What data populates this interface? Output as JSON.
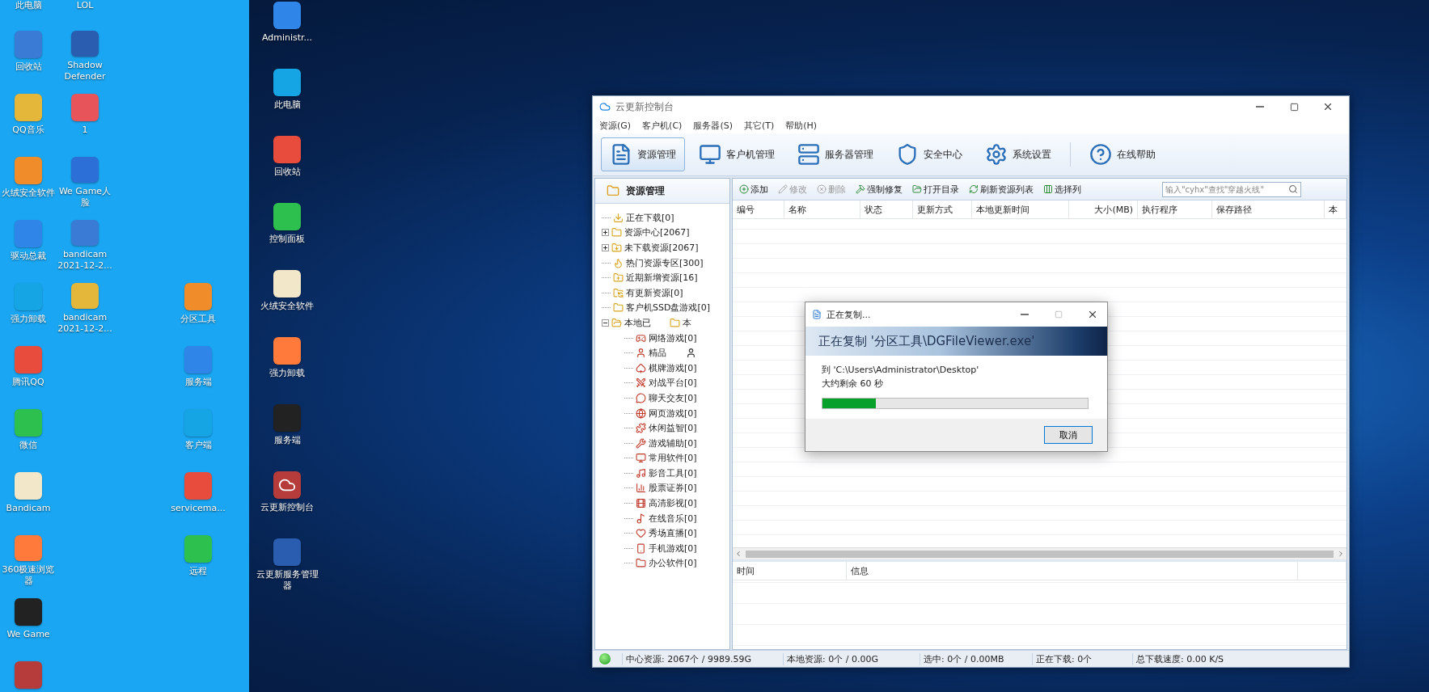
{
  "desktop": {
    "columns": [
      {
        "icons": [
          {
            "kind": "cut",
            "label": "此电脑"
          },
          {
            "kind": "app",
            "label": "回收站"
          },
          {
            "kind": "app",
            "label": "QQ音乐"
          },
          {
            "kind": "app",
            "label": "火绒安全软件"
          },
          {
            "kind": "app",
            "label": "驱动总裁"
          },
          {
            "kind": "app",
            "label": "强力卸载"
          },
          {
            "kind": "app",
            "label": "腾讯QQ"
          },
          {
            "kind": "app",
            "label": "微信"
          },
          {
            "kind": "app",
            "label": "Bandicam"
          },
          {
            "kind": "app",
            "label": "360极速浏览器"
          },
          {
            "kind": "app",
            "label": "We Game"
          },
          {
            "kind": "app"
          }
        ]
      },
      {
        "icons": [
          {
            "kind": "cut",
            "label": "LOL"
          },
          {
            "kind": "app",
            "label": "Shadow Defender"
          },
          {
            "kind": "app",
            "label": "1"
          },
          {
            "kind": "app",
            "label": "We Game人脸"
          },
          {
            "kind": "app",
            "label": "bandicam 2021-12-2..."
          },
          {
            "kind": "app",
            "label": "bandicam 2021-12-2..."
          }
        ]
      },
      {
        "icons": [
          {
            "kind": "app",
            "label": "分区工具"
          },
          {
            "kind": "app",
            "label": "服务端"
          },
          {
            "kind": "app",
            "label": "客户端"
          },
          {
            "kind": "app",
            "label": "servicema..."
          },
          {
            "kind": "app",
            "label": "远程"
          }
        ]
      }
    ],
    "dark_column": [
      {
        "label": "Administr..."
      },
      {
        "label": "此电脑"
      },
      {
        "label": "回收站"
      },
      {
        "label": "控制面板"
      },
      {
        "label": "火绒安全软件"
      },
      {
        "label": "强力卸载"
      },
      {
        "label": "服务端"
      },
      {
        "label": "云更新控制台"
      },
      {
        "label": "云更新服务管理器"
      }
    ]
  },
  "window": {
    "title": "云更新控制台",
    "menu": [
      "资源(G)",
      "客户机(C)",
      "服务器(S)",
      "其它(T)",
      "帮助(H)"
    ],
    "toolbar": [
      {
        "label": "资源管理",
        "selected": true
      },
      {
        "label": "客户机管理",
        "selected": false
      },
      {
        "label": "服务器管理",
        "selected": false
      },
      {
        "label": "安全中心",
        "selected": false
      },
      {
        "label": "系统设置",
        "selected": false
      },
      {
        "label": "在线帮助",
        "selected": false
      }
    ],
    "sidebar": {
      "title": "资源管理",
      "tree": [
        {
          "label": "正在下载[0]"
        },
        {
          "label": "资源中心[2067]",
          "expanded": false
        },
        {
          "label": "未下载资源[2067]",
          "expanded": false
        },
        {
          "label": "热门资源专区[300]"
        },
        {
          "label": "近期新增资源[16]"
        },
        {
          "label": "有更新资源[0]"
        },
        {
          "label": "客户机SSD盘游戏[0]"
        },
        {
          "label": "本地已",
          "ghost_label": "本",
          "expanded": true,
          "children": [
            {
              "label": "网络游戏[0]"
            },
            {
              "label": "精品",
              "ghost_icon": true
            },
            {
              "label": "棋牌游戏[0]"
            },
            {
              "label": "对战平台[0]"
            },
            {
              "label": "聊天交友[0]"
            },
            {
              "label": "网页游戏[0]"
            },
            {
              "label": "休闲益智[0]"
            },
            {
              "label": "游戏辅助[0]"
            },
            {
              "label": "常用软件[0]"
            },
            {
              "label": "影音工具[0]"
            },
            {
              "label": "股票证券[0]"
            },
            {
              "label": "高清影视[0]"
            },
            {
              "label": "在线音乐[0]"
            },
            {
              "label": "秀场直播[0]"
            },
            {
              "label": "手机游戏[0]"
            },
            {
              "label": "办公软件[0]"
            }
          ]
        }
      ]
    },
    "actions": [
      {
        "label": "添加",
        "disabled": false
      },
      {
        "label": "修改",
        "disabled": true
      },
      {
        "label": "删除",
        "disabled": true
      },
      {
        "label": "强制修复",
        "disabled": false
      },
      {
        "label": "打开目录",
        "disabled": false
      },
      {
        "label": "刷新资源列表",
        "disabled": false
      },
      {
        "label": "选择列",
        "disabled": false
      }
    ],
    "search": {
      "placeholder": "输入\"cyhx\"查找\"穿越火线\""
    },
    "table": {
      "columns": [
        "编号",
        "名称",
        "状态",
        "更新方式",
        "本地更新时间",
        "大小(MB)",
        "执行程序",
        "保存路径",
        "本"
      ]
    },
    "log": {
      "columns": [
        "时间",
        "信息"
      ]
    },
    "status_bar": [
      "中心资源: 2067个 / 9989.59G",
      "本地资源: 0个 / 0.00G",
      "选中: 0个 / 0.00MB",
      "正在下载: 0个",
      "总下载速度: 0.00 K/S"
    ]
  },
  "copy_dialog": {
    "title": "正在复制...",
    "heading": "正在复制 '分区工具\\DGFileViewer.exe'",
    "destination": "到 'C:\\Users\\Administrator\\Desktop'",
    "remaining": "大约剩余 60 秒",
    "level": 0.2,
    "button": "取消"
  }
}
